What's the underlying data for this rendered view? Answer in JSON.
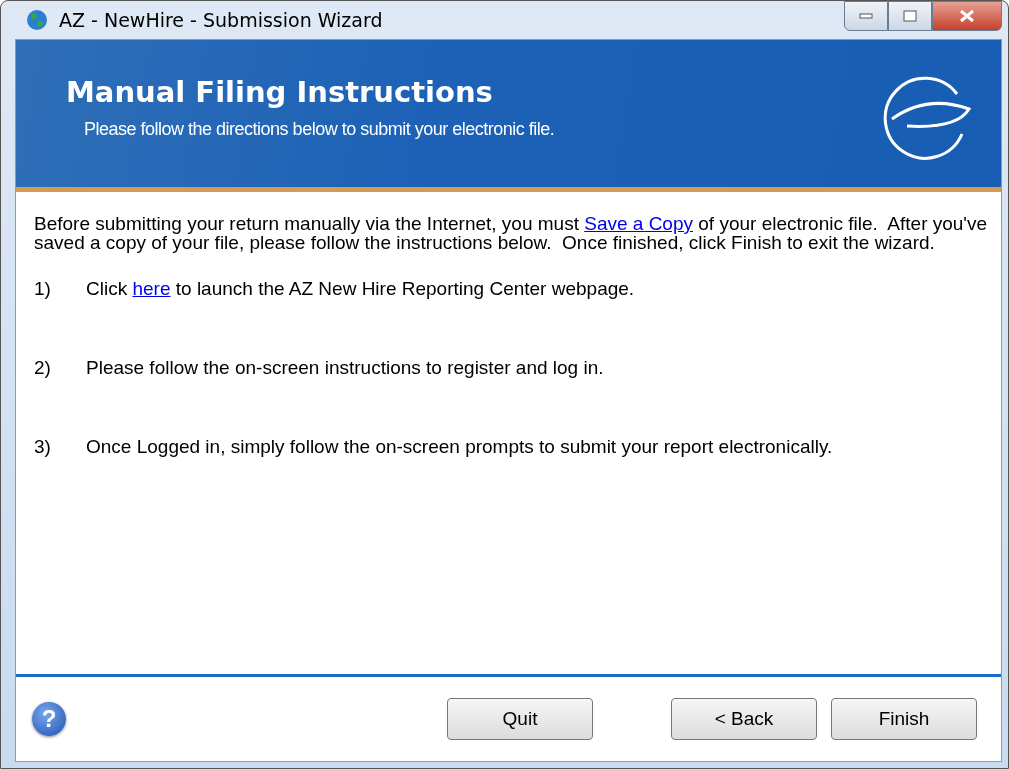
{
  "window": {
    "title": "AZ - NewHire - Submission Wizard"
  },
  "header": {
    "title": "Manual Filing Instructions",
    "subtitle": "Please follow the directions below to submit your electronic file."
  },
  "intro": {
    "before": "Before submitting your return manually via the Internet, you must",
    "link": "Save a Copy",
    "after": "of your electronic file.  After you've saved a copy of your file, please follow the instructions below.  Once finished, click Finish to exit the wizard."
  },
  "steps": [
    {
      "number": "1)",
      "before": "Click",
      "link": "here",
      "after": "to launch the AZ New Hire Reporting Center webpage."
    },
    {
      "number": "2)",
      "before": "Please follow the on-screen instructions to register and log in."
    },
    {
      "number": "3)",
      "before": "Once Logged in, simply follow the on-screen prompts to submit your report electronically."
    }
  ],
  "footer": {
    "help": "?",
    "buttons": [
      {
        "label": "Quit",
        "kind": "quit"
      },
      {
        "label": "< Back",
        "kind": "back"
      },
      {
        "label": "Finish",
        "kind": "finish"
      }
    ]
  }
}
